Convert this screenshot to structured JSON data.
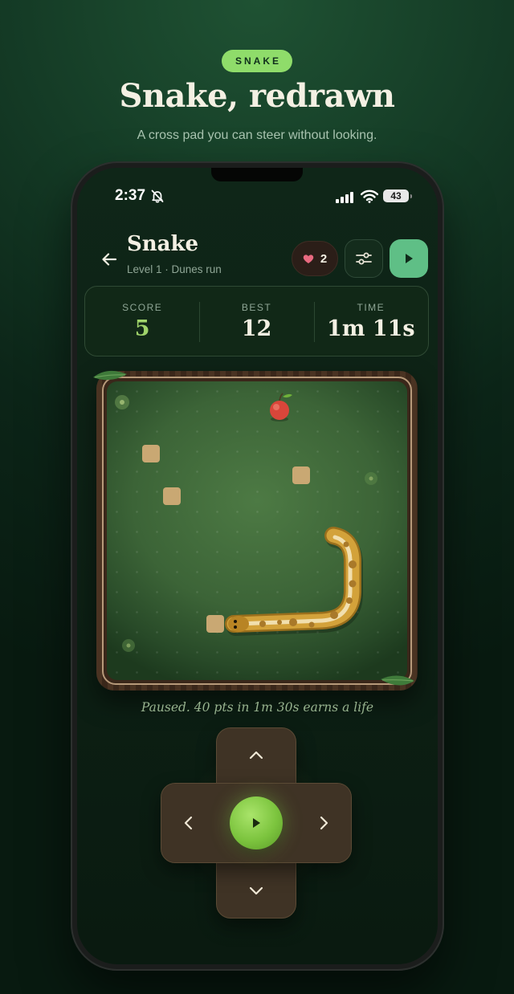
{
  "hero": {
    "eyebrow": "SNAKE",
    "title": "Snake, redrawn",
    "subtitle": "A cross pad you can steer without looking."
  },
  "status_bar": {
    "time": "2:37",
    "battery": "43",
    "icons": [
      "bell-slash-icon",
      "signal-icon",
      "wifi-icon",
      "battery-icon"
    ]
  },
  "header": {
    "title": "Snake",
    "subtitle": "Level 1 · Dunes run",
    "lives": "2",
    "back_icon": "arrow-left-icon",
    "settings_icon": "sliders-icon",
    "play_icon": "play-icon"
  },
  "stats": [
    {
      "label": "SCORE",
      "value": "5"
    },
    {
      "label": "BEST",
      "value": "12"
    },
    {
      "label": "TIME",
      "value": "1m 11s"
    }
  ],
  "board": {
    "items": [
      "apple",
      "sand-block",
      "sand-block",
      "sand-block",
      "sand-block",
      "snake"
    ]
  },
  "message": "Paused. 40 pts in 1m 30s earns a life",
  "controls": {
    "up": "chevron-up-icon",
    "down": "chevron-down-icon",
    "left": "chevron-left-icon",
    "right": "chevron-right-icon",
    "center": "play-icon"
  },
  "colors": {
    "accent": "#8fdc6a",
    "play_button": "#5fbf86",
    "score": "#9fd36a",
    "board": "#3c6437",
    "frame": "#4a3322",
    "snake": "#c9952e"
  }
}
